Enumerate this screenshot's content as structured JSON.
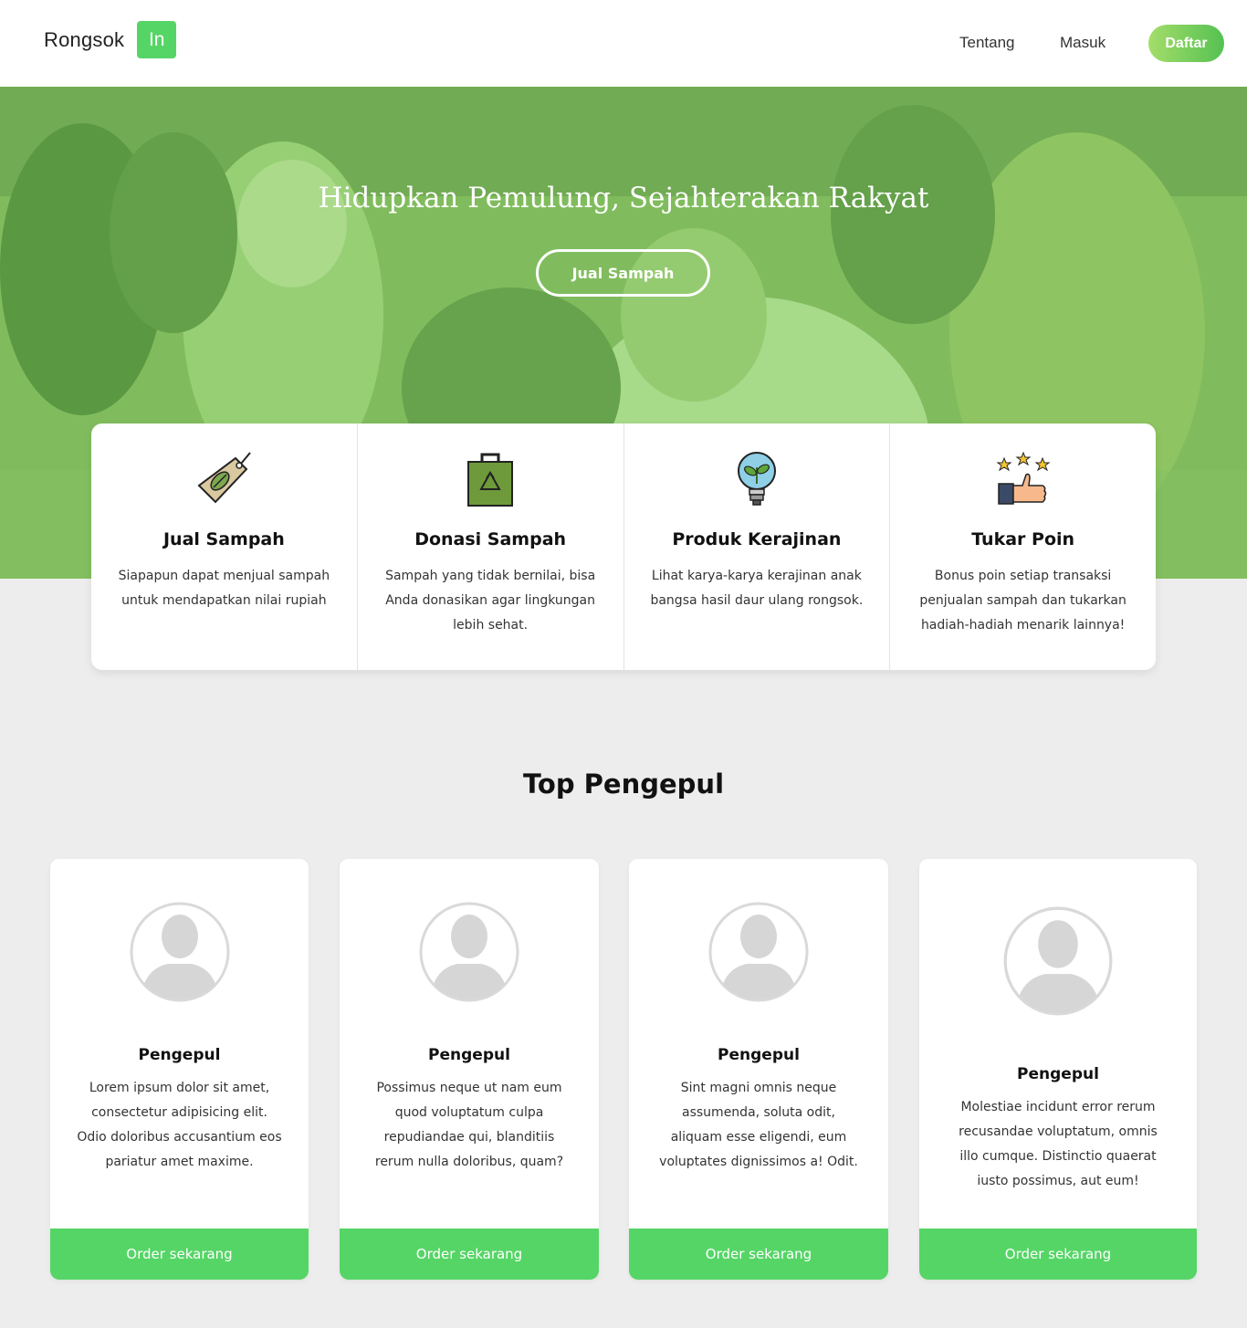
{
  "nav": {
    "brand_text": "Rongsok",
    "brand_badge": "In",
    "links": [
      "Tentang",
      "Masuk"
    ],
    "cta": "Daftar"
  },
  "hero": {
    "title": "Hidupkan Pemulung, Sejahterakan Rakyat",
    "button": "Jual Sampah"
  },
  "services": [
    {
      "icon": "leaf-tag-icon",
      "title": "Jual Sampah",
      "desc": "Siapapun dapat menjual sampah untuk mendapatkan nilai rupiah"
    },
    {
      "icon": "recycle-bag-icon",
      "title": "Donasi Sampah",
      "desc": "Sampah yang tidak bernilai, bisa Anda donasikan agar lingkungan lebih sehat."
    },
    {
      "icon": "plant-bulb-icon",
      "title": "Produk Kerajinan",
      "desc": "Lihat karya-karya kerajinan anak bangsa hasil daur ulang rongsok."
    },
    {
      "icon": "thumbs-up-stars-icon",
      "title": "Tukar Poin",
      "desc": "Bonus poin setiap transaksi penjualan sampah dan tukarkan hadiah-hadiah menarik lainnya!"
    }
  ],
  "top_section": {
    "title": "Top Pengepul",
    "cards": [
      {
        "name": "Pengepul",
        "desc": "Lorem ipsum dolor sit amet, consectetur adipisicing elit. Odio doloribus accusantium eos pariatur amet maxime.",
        "button": "Order sekarang"
      },
      {
        "name": "Pengepul",
        "desc": "Possimus neque ut nam eum quod voluptatum culpa repudiandae qui, blanditiis rerum nulla doloribus, quam?",
        "button": "Order sekarang"
      },
      {
        "name": "Pengepul",
        "desc": "Sint magni omnis neque assumenda, soluta odit, aliquam esse eligendi, eum voluptates dignissimos a! Odit.",
        "button": "Order sekarang"
      },
      {
        "name": "Pengepul",
        "desc": "Molestiae incidunt error rerum recusandae voluptatum, omnis illo cumque. Distinctio quaerat iusto possimus, aut eum!",
        "button": "Order sekarang"
      }
    ]
  },
  "colors": {
    "accent": "#55d566",
    "hero_overlay": "#76c85f",
    "page_bg": "#ededed"
  }
}
